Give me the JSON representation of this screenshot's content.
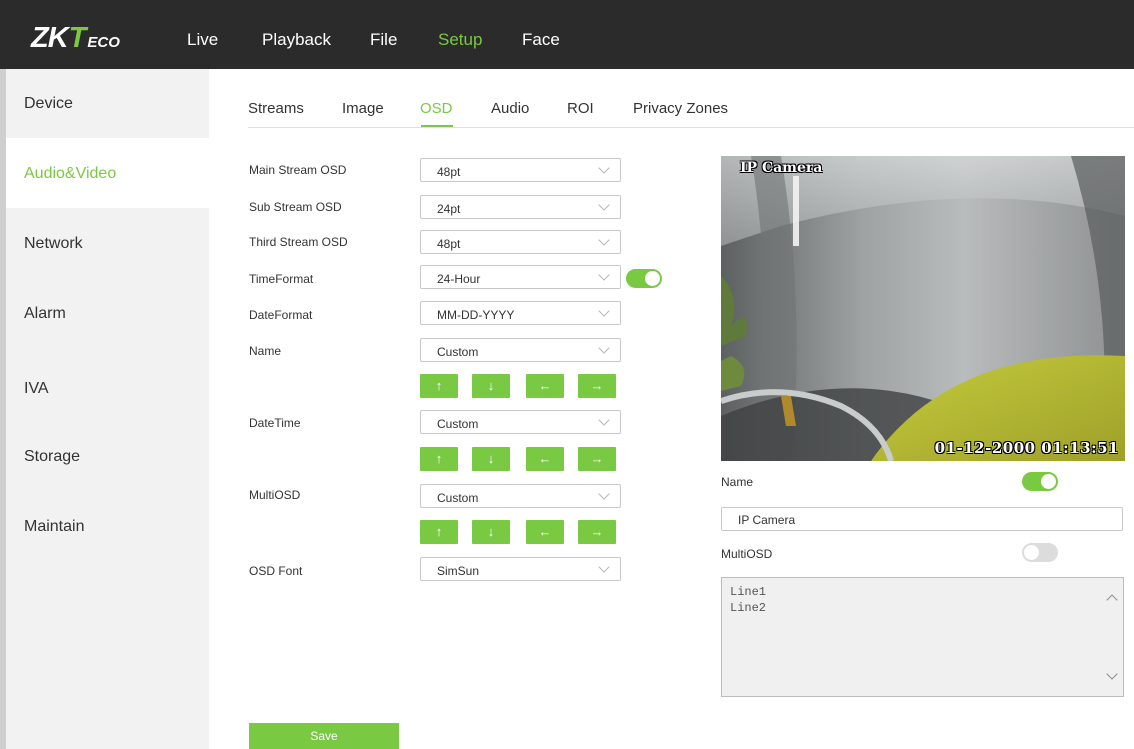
{
  "brand": {
    "logo_zk": "ZK",
    "logo_t": "T",
    "logo_eco": "ECO"
  },
  "topnav": {
    "live": "Live",
    "playback": "Playback",
    "file": "File",
    "setup": "Setup",
    "face": "Face",
    "active": "Setup"
  },
  "sidebar": {
    "items": [
      "Device",
      "Audio&Video",
      "Network",
      "Alarm",
      "IVA",
      "Storage",
      "Maintain"
    ],
    "active": "Audio&Video"
  },
  "tabs": {
    "items": [
      "Streams",
      "Image",
      "OSD",
      "Audio",
      "ROI",
      "Privacy Zones"
    ],
    "active": "OSD"
  },
  "form": {
    "main_stream_osd": {
      "label": "Main Stream OSD",
      "value": "48pt"
    },
    "sub_stream_osd": {
      "label": "Sub Stream OSD",
      "value": "24pt"
    },
    "third_stream_osd": {
      "label": "Third Stream OSD",
      "value": "48pt"
    },
    "time_format": {
      "label": "TimeFormat",
      "value": "24-Hour",
      "toggle": "on"
    },
    "date_format": {
      "label": "DateFormat",
      "value": "MM-DD-YYYY"
    },
    "name": {
      "label": "Name",
      "value": "Custom"
    },
    "datetime": {
      "label": "DateTime",
      "value": "Custom"
    },
    "multiosd": {
      "label": "MultiOSD",
      "value": "Custom"
    },
    "osd_font": {
      "label": "OSD Font",
      "value": "SimSun"
    },
    "arrows": {
      "up": "↑",
      "down": "↓",
      "left": "←",
      "right": "→"
    },
    "save_label": "Save"
  },
  "preview": {
    "osd_name": "IP Camera",
    "osd_datetime": "01-12-2000 01:13:51"
  },
  "right_panel": {
    "name_label": "Name",
    "name_toggle": "on",
    "name_value": "IP Camera",
    "multiosd_label": "MultiOSD",
    "multiosd_toggle": "off",
    "multiosd_lines": [
      "Line1",
      "Line2"
    ]
  },
  "colors": {
    "accent": "#7ac943",
    "topbar": "#2b2b2b",
    "sidebar": "#f2f2f2"
  }
}
